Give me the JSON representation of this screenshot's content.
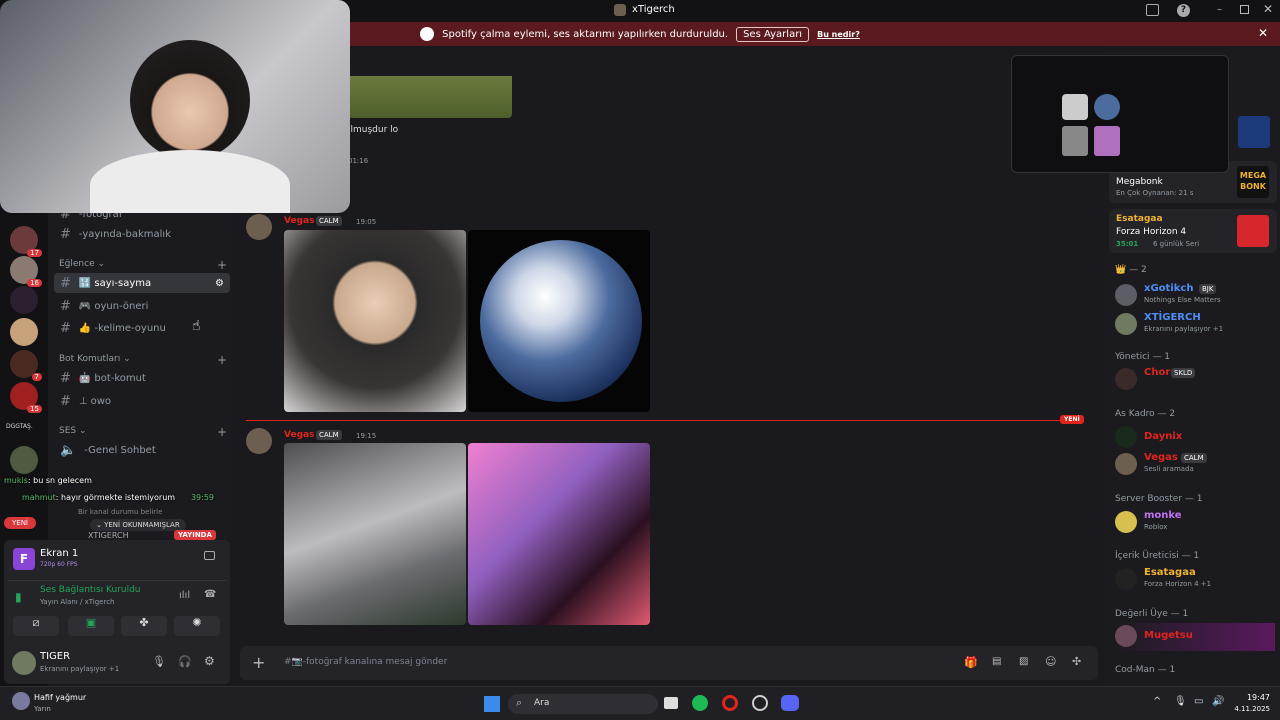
{
  "window": {
    "title": "xTigerch"
  },
  "banner": {
    "text": "Spotify çalma eylemi, ses aktarımı yapılırken durduruldu.",
    "button": "Ses Ayarları",
    "link": "Bu nedir?"
  },
  "servers": [
    {
      "badge": "17"
    },
    {
      "badge": "16"
    },
    {
      "badge": ""
    },
    {
      "badge": ""
    },
    {
      "badge": "7"
    },
    {
      "badge": "15"
    },
    {
      "label": "DGGTAŞ."
    },
    {
      "badge": ""
    }
  ],
  "channels": {
    "top": [
      {
        "name": "-fotoğraf"
      },
      {
        "name": "-yayında-bakmalık"
      }
    ],
    "cat_fun": "Eğlence",
    "fun": [
      {
        "name": "sayı-sayma",
        "prefix": "🔢"
      },
      {
        "name": "oyun-öneri",
        "prefix": "🎮"
      },
      {
        "name": "-kelime-oyunu",
        "prefix": "👍"
      }
    ],
    "cat_bot": "Bot Komutları",
    "bot": [
      {
        "name": "bot-komut",
        "prefix": "🤖"
      },
      {
        "name": "owo",
        "prefix": "⊥"
      }
    ],
    "cat_voice": "SES",
    "voice": [
      {
        "name": "-Genel Sohbet"
      }
    ],
    "overlay_chat": [
      {
        "user": "mukis",
        "text": ": bu sn gelecem"
      },
      {
        "user": "mahmut",
        "text": ": hayır görmekte istemiyorum"
      }
    ],
    "overlay_time": "39:59",
    "new_badge": "YENİ",
    "unread_pill": "YENİ OKUNMAMIŞLAR",
    "live_badge": "YAYINDA",
    "live_user": "XTIGERCH",
    "status_hint": "Bir kanal durumu belirle"
  },
  "panel": {
    "screen_title": "Ekran 1",
    "screen_sub": "720p 60 FPS",
    "screen_letter": "F",
    "voice_status": "Ses Bağlantısı Kuruldu",
    "voice_sub": "Yayın Alanı",
    "voice_sub2": "/ xTigerch",
    "user_name": "TIGER",
    "user_status": "Ekranını paylaşıyor +1"
  },
  "chat": {
    "partial_text": "ılmuşdur lo",
    "partial_time": "01:16",
    "messages": [
      {
        "user": "Vegas",
        "tag": "CALM",
        "time": "19:05"
      },
      {
        "user": "Vegas",
        "tag": "CALM",
        "time": "19:15"
      }
    ],
    "new_divider": "YENİ",
    "composer_placeholder": "#📷-fotoğraf kanalına mesaj gönder"
  },
  "members": {
    "top_items": [
      {
        "game": "Megabonk",
        "sub": "En Çok Oynanan: 21 s",
        "tile": "MEGA BONK"
      },
      {
        "user": "Esatagaa",
        "game": "Forza Horizon 4",
        "time": "35:01",
        "streak": "6 günlük Seri"
      }
    ],
    "group_crown": "— 2",
    "crown_members": [
      {
        "name": "xGotikch",
        "tag": "BJK",
        "status": "Nothings Else Matters"
      },
      {
        "name": "XTİGERCH",
        "status": "Ekranını paylaşıyor +1"
      }
    ],
    "group_mod": "Yönetici — 1",
    "mod_members": [
      {
        "name": "Chor",
        "tag": "SKLD"
      }
    ],
    "group_kadro": "As Kadro — 2",
    "kadro_members": [
      {
        "name": "Daynix",
        "status": ""
      },
      {
        "name": "Vegas",
        "tag": "CALM",
        "status": "Sesli aramada"
      }
    ],
    "group_booster": "Server Booster — 1",
    "booster_members": [
      {
        "name": "monke",
        "status": "Roblox"
      }
    ],
    "group_content": "İçerik Üreticisi — 1",
    "content_members": [
      {
        "name": "Esatagaa",
        "status": "Forza Horizon 4 +1"
      }
    ],
    "group_valued": "Değerli Üye — 1",
    "valued_members": [
      {
        "name": "Mugetsu"
      }
    ],
    "group_codman": "Cod-Man — 1"
  },
  "taskbar": {
    "weather_title": "Hafif yağmur",
    "weather_sub": "Yarın",
    "search": "Ara",
    "time": "19:47",
    "date": "4.11.2025"
  },
  "colors": {
    "red": "#e0251d",
    "banner": "#5a1a1f",
    "green": "#23a55a",
    "yellow": "#f0b232",
    "blue": "#4e8ff7"
  }
}
